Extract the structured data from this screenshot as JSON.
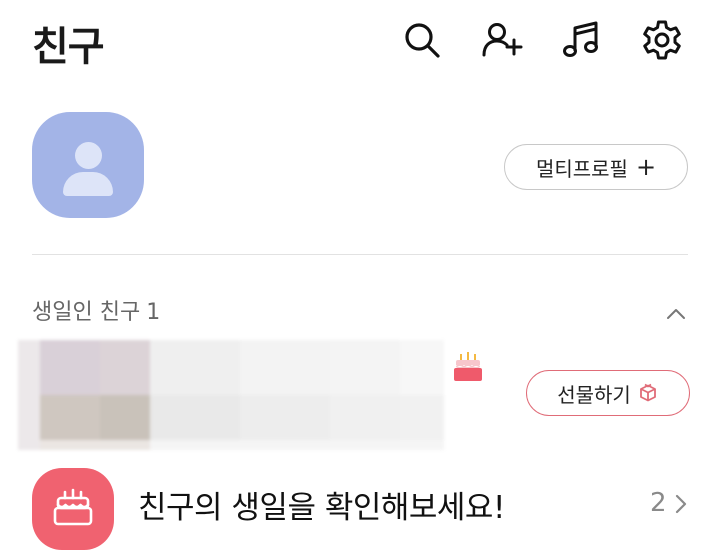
{
  "header": {
    "title": "친구",
    "icons": [
      "search-icon",
      "add-friend-icon",
      "music-icon",
      "settings-icon"
    ]
  },
  "profile": {
    "multi_profile_label": "멀티프로필",
    "multi_profile_plus": "+"
  },
  "birthday_section": {
    "label": "생일인 친구",
    "count": "1",
    "gift_label": "선물하기"
  },
  "birthday_banner": {
    "text": "친구의 생일을 확인해보세요!",
    "count": "2"
  },
  "colors": {
    "avatar_bg": "#a3b4e7",
    "gift_border": "#e06c78",
    "birthday_icon_bg": "#f06270"
  }
}
